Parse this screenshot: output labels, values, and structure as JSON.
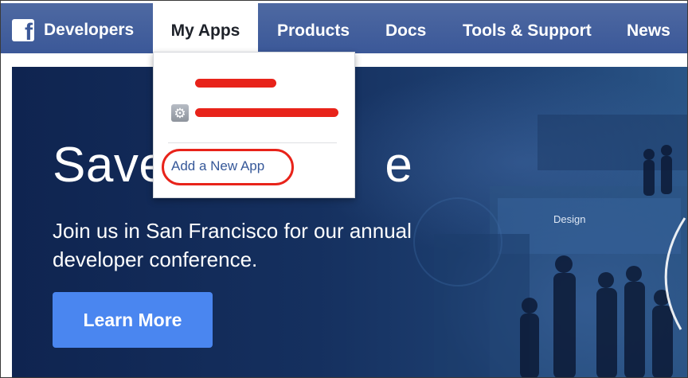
{
  "header": {
    "brand": "Developers",
    "nav": [
      {
        "label": "My Apps",
        "active": true
      },
      {
        "label": "Products",
        "active": false
      },
      {
        "label": "Docs",
        "active": false
      },
      {
        "label": "Tools & Support",
        "active": false
      },
      {
        "label": "News",
        "active": false
      }
    ]
  },
  "dropdown": {
    "apps": [
      {
        "label": "",
        "redacted": true,
        "icon": null
      },
      {
        "label": "",
        "redacted": true,
        "icon": "gear-icon"
      }
    ],
    "add_app": "Add a New App"
  },
  "hero": {
    "title": "Save",
    "title_tail": "e",
    "subtitle": "Join us in San Francisco for our annual developer conference.",
    "button": "Learn More",
    "sign": "Design"
  },
  "colors": {
    "nav_bg": "#3b5898",
    "hero_bg": "#15305f",
    "button": "#4a86f0",
    "annotation": "#e8231a",
    "link": "#365899"
  }
}
